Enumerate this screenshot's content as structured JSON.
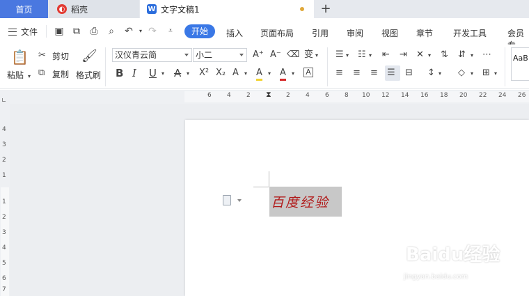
{
  "tabs": {
    "home": "首页",
    "daoke": "稻壳",
    "doc": "文字文稿1",
    "add": "+"
  },
  "menu": {
    "file": "文件",
    "items": [
      "开始",
      "插入",
      "页面布局",
      "引用",
      "审阅",
      "视图",
      "章节",
      "开发工具",
      "会员专"
    ]
  },
  "ribbon": {
    "paste": "粘贴",
    "cut": "剪切",
    "copy": "复制",
    "format_painter": "格式刷",
    "font_name": "汉仪青云简",
    "font_size": "小二",
    "style_preview": "AaB",
    "bold": "B",
    "italic": "I",
    "underline": "U",
    "strike": "A",
    "superscript": "X²",
    "subscript": "X₂",
    "text_effect": "A",
    "highlight": "A",
    "font_color": "A",
    "char_border": "A",
    "grow_font": "A⁺",
    "shrink_font": "A⁻",
    "pinyin": "变"
  },
  "ruler": {
    "h_numbers": [
      "6",
      "4",
      "2",
      "2",
      "4",
      "6",
      "8",
      "10",
      "12",
      "14",
      "16",
      "18",
      "20",
      "22",
      "24",
      "26"
    ],
    "v_numbers": [
      "4",
      "3",
      "2",
      "1",
      "1",
      "2",
      "3",
      "4",
      "5",
      "6",
      "7"
    ]
  },
  "document": {
    "text": "百度经验"
  },
  "watermark": {
    "brand": "Baidu经验",
    "url": "jingyan.baidu.com"
  },
  "colors": {
    "accent": "#3a78e6",
    "home_tab": "#4a78e0",
    "doc_text": "#b11b1b",
    "selection": "#c8c8c8"
  }
}
